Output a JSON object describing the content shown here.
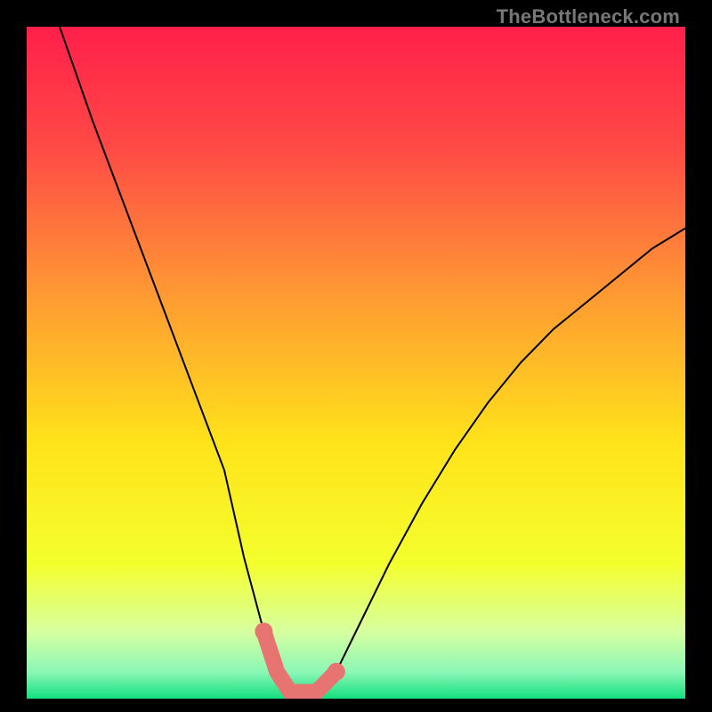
{
  "watermark": "TheBottleneck.com",
  "chart_data": {
    "type": "line",
    "title": "",
    "xlabel": "",
    "ylabel": "",
    "xlim": [
      0,
      100
    ],
    "ylim": [
      0,
      100
    ],
    "series": [
      {
        "name": "bottleneck-curve",
        "x": [
          5,
          10,
          15,
          20,
          25,
          30,
          33,
          36,
          38,
          40,
          42,
          44,
          47,
          50,
          55,
          60,
          65,
          70,
          75,
          80,
          85,
          90,
          95,
          100
        ],
        "values": [
          100,
          86,
          73,
          60,
          47,
          34,
          21,
          10,
          4,
          1,
          1,
          1,
          4,
          10,
          20,
          29,
          37,
          44,
          50,
          55,
          59,
          63,
          67,
          70
        ]
      }
    ],
    "annotations": [
      {
        "name": "optimum-band",
        "x_start": 36,
        "x_end": 47,
        "color": "#e77470"
      }
    ],
    "background": {
      "type": "vertical-gradient",
      "stops": [
        {
          "pos": 0.0,
          "color": "#ff1f4a"
        },
        {
          "pos": 0.18,
          "color": "#ff4a46"
        },
        {
          "pos": 0.4,
          "color": "#ff9a33"
        },
        {
          "pos": 0.62,
          "color": "#ffe31a"
        },
        {
          "pos": 0.8,
          "color": "#f4ff2e"
        },
        {
          "pos": 0.9,
          "color": "#d7ffa0"
        },
        {
          "pos": 0.96,
          "color": "#8cf7b6"
        },
        {
          "pos": 1.0,
          "color": "#13e07e"
        }
      ]
    }
  }
}
